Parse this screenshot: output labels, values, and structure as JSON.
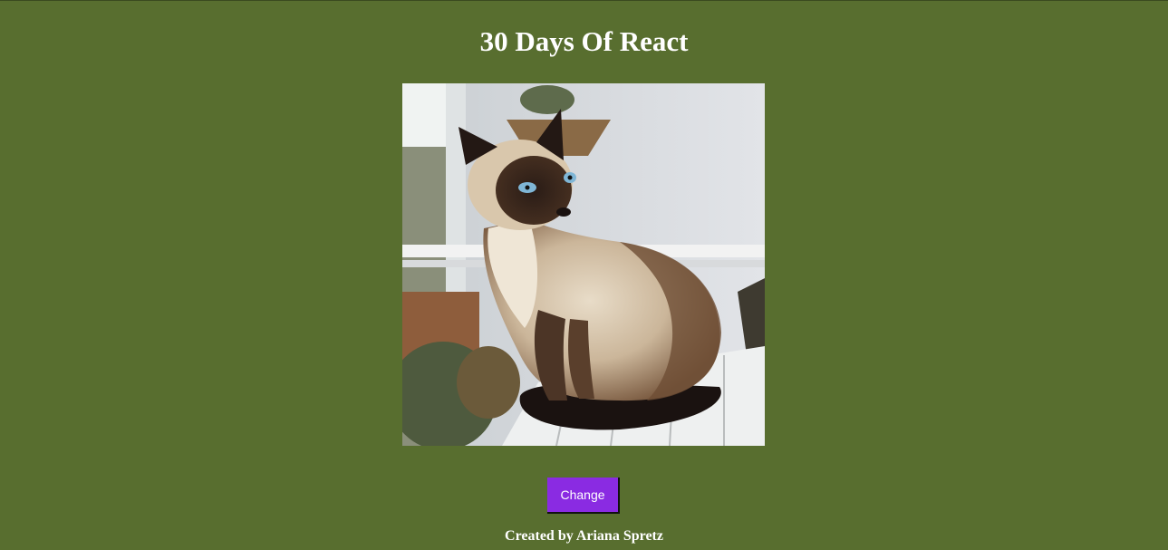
{
  "page": {
    "title": "30 Days Of React",
    "background_color": "#586e2f"
  },
  "image": {
    "subject": "siamese-cat-photo"
  },
  "controls": {
    "change_label": "Change",
    "button_color": "#8a2be2"
  },
  "footer": {
    "credit": "Created by Ariana Spretz"
  }
}
